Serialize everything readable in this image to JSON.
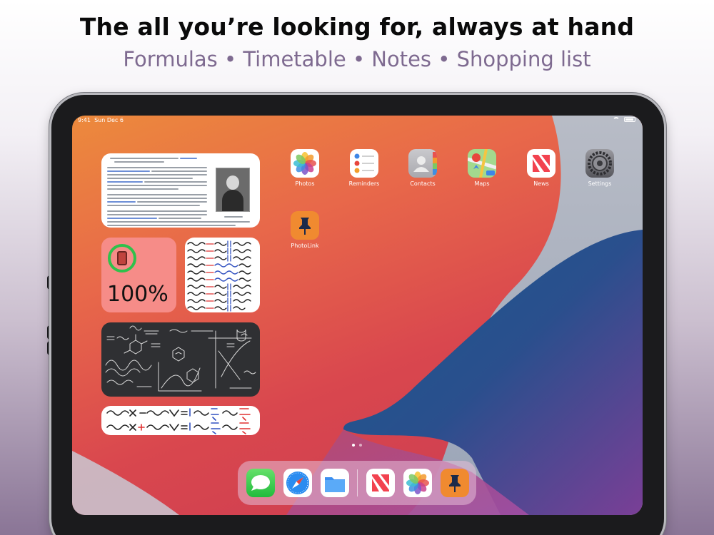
{
  "promo": {
    "headline": "The all you’re looking for, always at hand",
    "subline": "Formulas • Timetable • Notes • Shopping list"
  },
  "status_bar": {
    "time": "9:41",
    "date": "Sun Dec 6"
  },
  "widgets": {
    "battery": {
      "percent_text": "100%",
      "level": 1.0
    }
  },
  "apps": [
    {
      "label": "Photos",
      "icon": "photos-icon"
    },
    {
      "label": "Reminders",
      "icon": "reminders-icon"
    },
    {
      "label": "Contacts",
      "icon": "contacts-icon"
    },
    {
      "label": "Maps",
      "icon": "maps-icon"
    },
    {
      "label": "News",
      "icon": "news-icon"
    },
    {
      "label": "Settings",
      "icon": "settings-icon"
    },
    {
      "label": "PhotoLink",
      "icon": "photolink-icon"
    }
  ],
  "dock": [
    {
      "icon": "messages-icon"
    },
    {
      "icon": "safari-icon"
    },
    {
      "icon": "files-icon"
    },
    {
      "icon": "news-icon"
    },
    {
      "icon": "photos-icon"
    },
    {
      "icon": "photolink-icon"
    }
  ],
  "page_dots": {
    "count": 2,
    "active": 0
  },
  "colors": {
    "subline": "#7e6a90",
    "photolink": "#f08a30",
    "battery_ring": "#2fc14b",
    "battery_widget": "#f68c88"
  }
}
